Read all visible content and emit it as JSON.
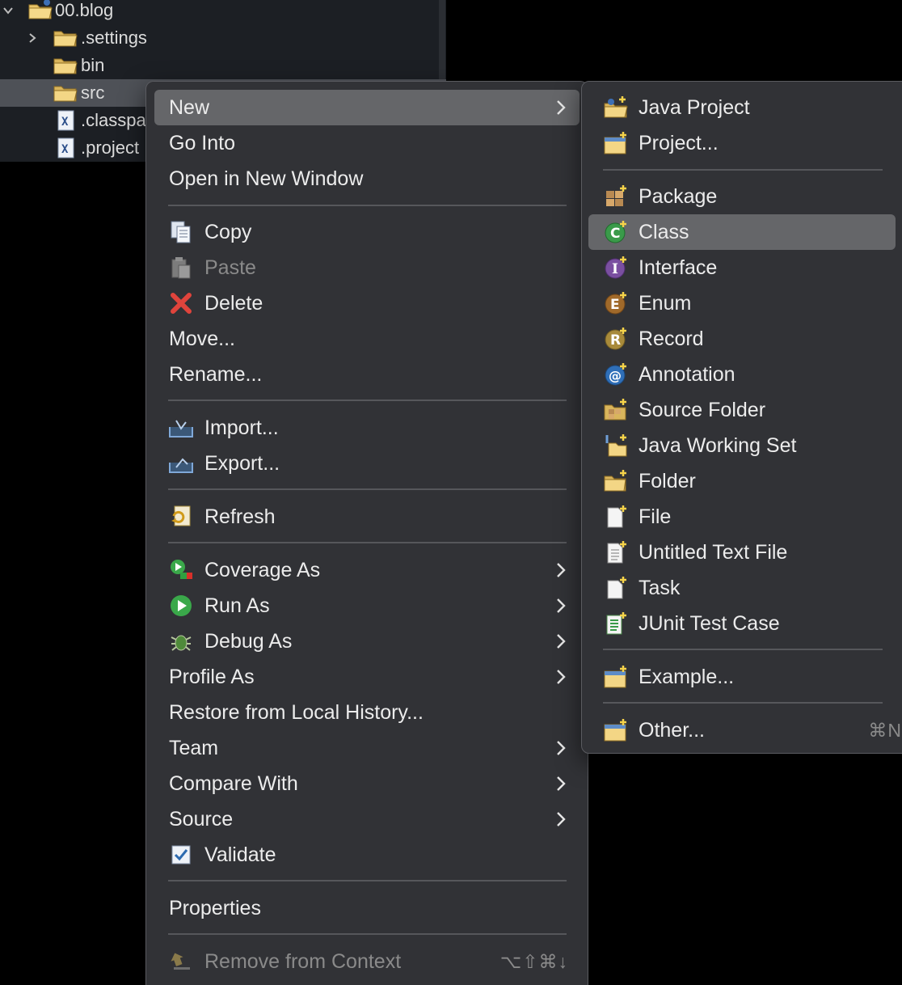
{
  "tree": {
    "items": [
      {
        "label": "00.blog",
        "icon": "java-project-folder-icon"
      },
      {
        "label": ".settings",
        "icon": "folder-icon"
      },
      {
        "label": "bin",
        "icon": "folder-icon"
      },
      {
        "label": "src",
        "icon": "folder-icon"
      },
      {
        "label": ".classpa",
        "icon": "xml-file-icon"
      },
      {
        "label": ".project",
        "icon": "xml-file-icon"
      }
    ]
  },
  "context_menu": {
    "items": [
      {
        "label": "New",
        "submenu": true
      },
      {
        "label": "Go Into"
      },
      {
        "label": "Open in New Window"
      },
      {
        "label": "Copy",
        "icon": "copy-icon"
      },
      {
        "label": "Paste",
        "icon": "paste-icon",
        "disabled": true
      },
      {
        "label": "Delete",
        "icon": "delete-icon"
      },
      {
        "label": "Move..."
      },
      {
        "label": "Rename..."
      },
      {
        "label": "Import...",
        "icon": "import-icon"
      },
      {
        "label": "Export...",
        "icon": "export-icon"
      },
      {
        "label": "Refresh",
        "icon": "refresh-icon"
      },
      {
        "label": "Coverage As",
        "icon": "coverage-icon",
        "submenu": true
      },
      {
        "label": "Run As",
        "icon": "run-icon",
        "submenu": true
      },
      {
        "label": "Debug As",
        "icon": "debug-icon",
        "submenu": true
      },
      {
        "label": "Profile As",
        "submenu": true
      },
      {
        "label": "Restore from Local History..."
      },
      {
        "label": "Team",
        "submenu": true
      },
      {
        "label": "Compare With",
        "submenu": true
      },
      {
        "label": "Source",
        "submenu": true
      },
      {
        "label": "Validate",
        "icon": "checkbox-checked-icon"
      },
      {
        "label": "Properties"
      },
      {
        "label": "Remove from Context",
        "icon": "remove-context-icon",
        "disabled": true,
        "shortcut": "⌥⇧⌘↓"
      }
    ]
  },
  "new_submenu": {
    "items": [
      {
        "label": "Java Project",
        "icon": "java-project-icon"
      },
      {
        "label": "Project...",
        "icon": "project-icon"
      },
      {
        "label": "Package",
        "icon": "package-icon"
      },
      {
        "label": "Class",
        "icon": "class-icon",
        "highlighted": true
      },
      {
        "label": "Interface",
        "icon": "interface-icon"
      },
      {
        "label": "Enum",
        "icon": "enum-icon"
      },
      {
        "label": "Record",
        "icon": "record-icon"
      },
      {
        "label": "Annotation",
        "icon": "annotation-icon"
      },
      {
        "label": "Source Folder",
        "icon": "source-folder-icon"
      },
      {
        "label": "Java Working Set",
        "icon": "working-set-icon"
      },
      {
        "label": "Folder",
        "icon": "folder-icon"
      },
      {
        "label": "File",
        "icon": "file-icon"
      },
      {
        "label": "Untitled Text File",
        "icon": "text-file-icon"
      },
      {
        "label": "Task",
        "icon": "task-icon"
      },
      {
        "label": "JUnit Test Case",
        "icon": "junit-icon"
      },
      {
        "label": "Example...",
        "icon": "example-icon"
      },
      {
        "label": "Other...",
        "icon": "other-icon",
        "shortcut": "⌘N"
      }
    ]
  },
  "colors": {
    "menu_bg": "#313236",
    "highlight": "#656669",
    "tree_bg": "#1c1f24",
    "tree_selected": "#4e5157"
  }
}
